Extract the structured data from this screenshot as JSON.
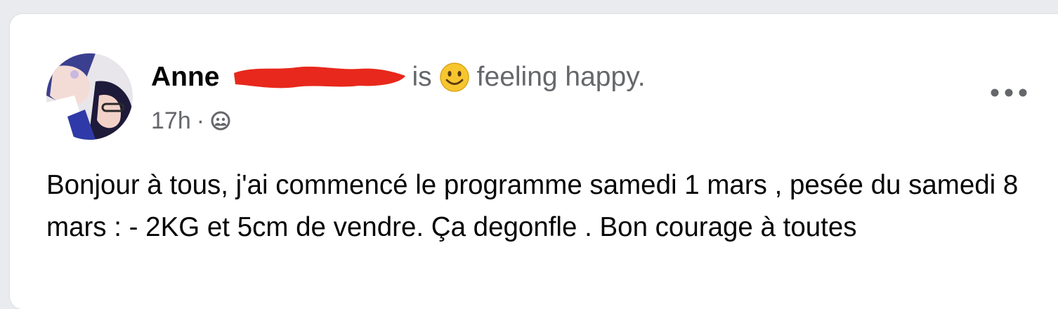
{
  "post": {
    "author_name": "Anne",
    "is_text": "is",
    "feeling_text": "feeling happy.",
    "feeling_icon": "smiling-face-emoji",
    "timestamp": "17h",
    "separator": "·",
    "audience_icon": "friends-icon",
    "menu_icon": "more-options-icon",
    "body": "Bonjour à tous, j'ai commencé le programme samedi 1 mars , pesée du samedi 8 mars : - 2KG et 5cm de vendre. Ça degonfle . Bon courage à toutes"
  },
  "colors": {
    "background": "#e9ebee",
    "card": "#ffffff",
    "text_primary": "#050505",
    "text_secondary": "#65676b",
    "redaction": "#e8281c",
    "emoji": "#f7c62f"
  }
}
